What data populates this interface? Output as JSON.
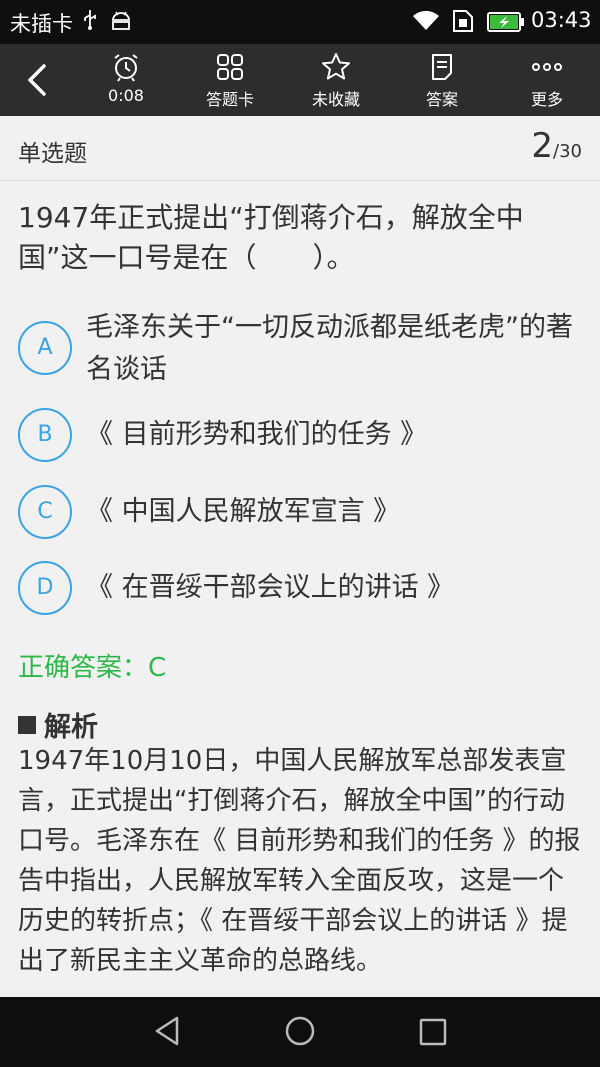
{
  "status_bar": {
    "carrier": "未插卡",
    "time": "03:43",
    "icons": [
      "usb-icon",
      "android-debug-icon",
      "wifi-icon",
      "sim-icon",
      "battery-charging-icon"
    ]
  },
  "toolbar": {
    "back_icon": "back-arrow-icon",
    "timer": "0:08",
    "answer_card": "答题卡",
    "favorite": "未收藏",
    "answer": "答案",
    "more": "更多"
  },
  "question": {
    "type": "单选题",
    "current": "2",
    "total": "/30",
    "text": "1947年正式提出“打倒蒋介石，解放全中国”这一口号是在（　　）。",
    "options": [
      {
        "letter": "A",
        "text": "毛泽东关于“一切反动派都是纸老虎”的著名谈话"
      },
      {
        "letter": "B",
        "text": "《 目前形势和我们的任务 》"
      },
      {
        "letter": "C",
        "text": "《 中国人民解放军宣言 》"
      },
      {
        "letter": "D",
        "text": "《 在晋绥干部会议上的讲话 》"
      }
    ],
    "correct_answer": "正确答案：C"
  },
  "analysis": {
    "title": "解析",
    "body": "1947年10月10日，中国人民解放军总部发表宣言，正式提出“打倒蒋介石，解放全中国”的行动口号。毛泽东在《 目前形势和我们的任务 》的报告中指出，人民解放军转入全面反攻，这是一个历史的转折点；《 在晋绥干部会议上的讲话 》提出了新民主主义革命的总路线。"
  },
  "colors": {
    "accent_blue": "#3aa3e3",
    "correct_green": "#2fb84a",
    "toolbar_bg": "#2d2d2d",
    "status_bg": "#0f0f0f"
  }
}
